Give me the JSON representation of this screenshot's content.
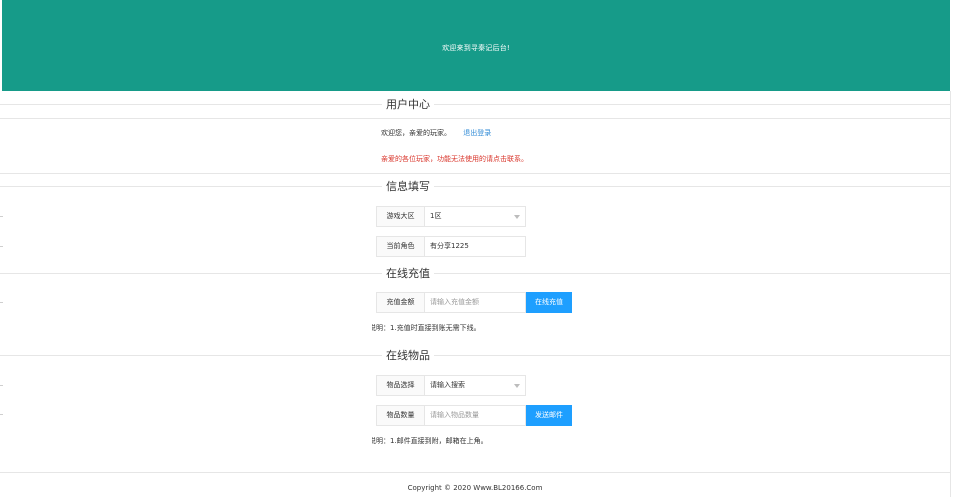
{
  "header": {
    "title": "欢迎来到寻秦记后台!"
  },
  "user_center": {
    "legend": "用户中心",
    "welcome_text": "欢迎您，亲爱的玩家。",
    "logout_label": "退出登录",
    "notice": "亲爱的各位玩家，功能无法使用的请点击联系。"
  },
  "info_fill": {
    "legend": "信息填写",
    "zone_label": "游戏大区",
    "zone_value": "1区",
    "role_label": "当前角色",
    "role_value": "有分享1225"
  },
  "recharge": {
    "legend": "在线充值",
    "amount_label": "充值金额",
    "amount_placeholder": "请输入充值金额",
    "button_label": "在线充值",
    "note": "说明：1.充值时直接到账无需下线。"
  },
  "items": {
    "legend": "在线物品",
    "select_label": "物品选择",
    "select_value": "请输入搜索",
    "qty_label": "物品数量",
    "qty_placeholder": "请输入物品数量",
    "button_label": "发送邮件",
    "note": "说明：1.邮件直接到附，邮箱在上角。"
  },
  "footer": {
    "copyright": "Copyright © 2020 Www.BL20166.Com"
  },
  "colors": {
    "header_bg": "#169b89",
    "button_bg": "#1e9fff",
    "link": "#2f8ad6",
    "notice": "#d9352b"
  }
}
